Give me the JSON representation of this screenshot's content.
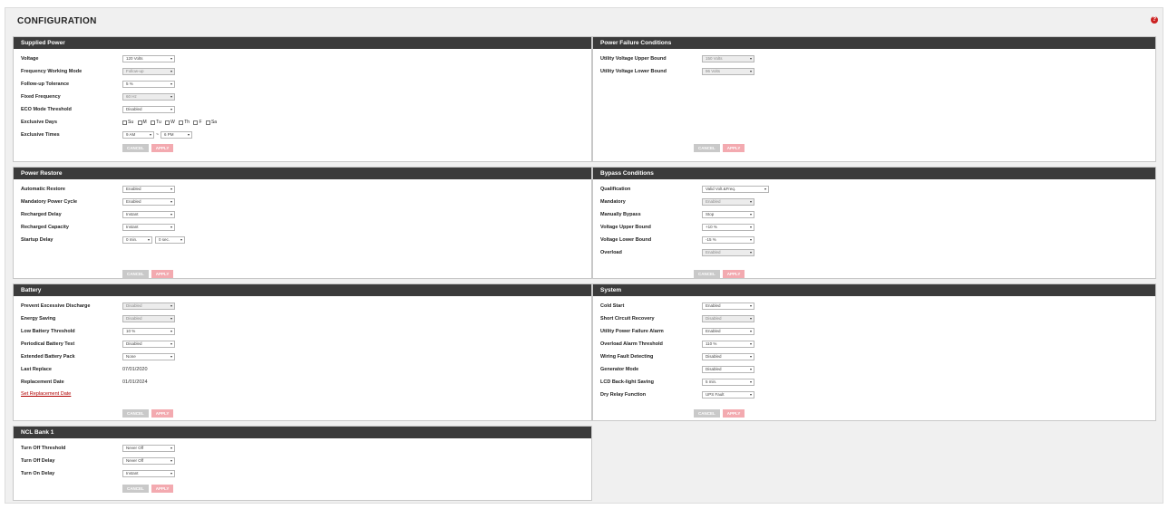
{
  "page": {
    "title": "CONFIGURATION"
  },
  "panels": {
    "supplied_power": {
      "title": "Supplied Power",
      "rows": [
        {
          "label": "Voltage",
          "value": "120 Volts"
        },
        {
          "label": "Frequency Working Mode",
          "value": "Follow-up"
        },
        {
          "label": "Follow-up Tolerance",
          "value": "5 %"
        },
        {
          "label": "Fixed Frequency",
          "value": "60 Hz"
        },
        {
          "label": "ECO Mode Threshold",
          "value": "Disabled"
        },
        {
          "label": "Exclusive Days"
        },
        {
          "label": "Exclusive Times",
          "start": "9 AM",
          "end": "6 PM"
        }
      ],
      "days": [
        "Su",
        "M",
        "Tu",
        "W",
        "Th",
        "F",
        "Sa"
      ]
    },
    "power_failure": {
      "title": "Power Failure Conditions",
      "rows": [
        {
          "label": "Utility Voltage Upper Bound",
          "value": "150 Volts"
        },
        {
          "label": "Utility Voltage Lower Bound",
          "value": "96 Volts"
        }
      ]
    },
    "power_restore": {
      "title": "Power Restore",
      "rows": [
        {
          "label": "Automatic Restore",
          "value": "Enabled"
        },
        {
          "label": "Mandatory Power Cycle",
          "value": "Enabled"
        },
        {
          "label": "Recharged Delay",
          "value": "Instant"
        },
        {
          "label": "Recharged Capacity",
          "value": "Instant"
        },
        {
          "label": "Startup Delay",
          "minutes": "0 min.",
          "seconds": "0 sec."
        }
      ]
    },
    "bypass": {
      "title": "Bypass Conditions",
      "rows": [
        {
          "label": "Qualification",
          "value": "Valid Volt.&Freq."
        },
        {
          "label": "Mandatory",
          "value": "Enabled"
        },
        {
          "label": "Manually Bypass",
          "value": "Stop"
        },
        {
          "label": "Voltage Upper Bound",
          "value": "+10 %"
        },
        {
          "label": "Voltage Lower Bound",
          "value": "-15 %"
        },
        {
          "label": "Overload",
          "value": "Enabled"
        }
      ]
    },
    "battery": {
      "title": "Battery",
      "rows": [
        {
          "label": "Prevent Excessive Discharge",
          "value": "Disabled"
        },
        {
          "label": "Energy Saving",
          "value": "Disabled"
        },
        {
          "label": "Low Battery Threshold",
          "value": "10 %"
        },
        {
          "label": "Periodical Battery Test",
          "value": "Disabled"
        },
        {
          "label": "Extended Battery Pack",
          "value": "None"
        },
        {
          "label": "Last Replace",
          "value": "07/01/2020"
        },
        {
          "label": "Replacement Date",
          "value": "01/01/2024"
        }
      ],
      "link": "Set Replacement Date"
    },
    "system": {
      "title": "System",
      "rows": [
        {
          "label": "Cold Start",
          "value": "Enabled"
        },
        {
          "label": "Short Circuit Recovery",
          "value": "Disabled"
        },
        {
          "label": "Utility Power Failure Alarm",
          "value": "Enabled"
        },
        {
          "label": "Overload Alarm Threshold",
          "value": "110 %"
        },
        {
          "label": "Wiring Fault Detecting",
          "value": "Disabled"
        },
        {
          "label": "Generator Mode",
          "value": "Disabled"
        },
        {
          "label": "LCD Back-light Saving",
          "value": "5 min."
        },
        {
          "label": "Dry Relay Function",
          "value": "UPS Fault"
        }
      ]
    },
    "ncl_bank": {
      "title": "NCL Bank 1",
      "rows": [
        {
          "label": "Turn Off Threshold",
          "value": "Never Off"
        },
        {
          "label": "Turn Off Delay",
          "value": "Never Off"
        },
        {
          "label": "Turn On Delay",
          "value": "Instant"
        }
      ]
    }
  },
  "buttons": {
    "cancel": "CANCEL",
    "apply": "APPLY"
  },
  "icons": {
    "help": "help-icon",
    "dropdown": "chevron-down-icon"
  },
  "colors": {
    "header": "#3b3b3b",
    "apply": "#f3aab0",
    "cancel": "#c9c9c9",
    "link": "#b00000",
    "help": "#cc2222"
  }
}
